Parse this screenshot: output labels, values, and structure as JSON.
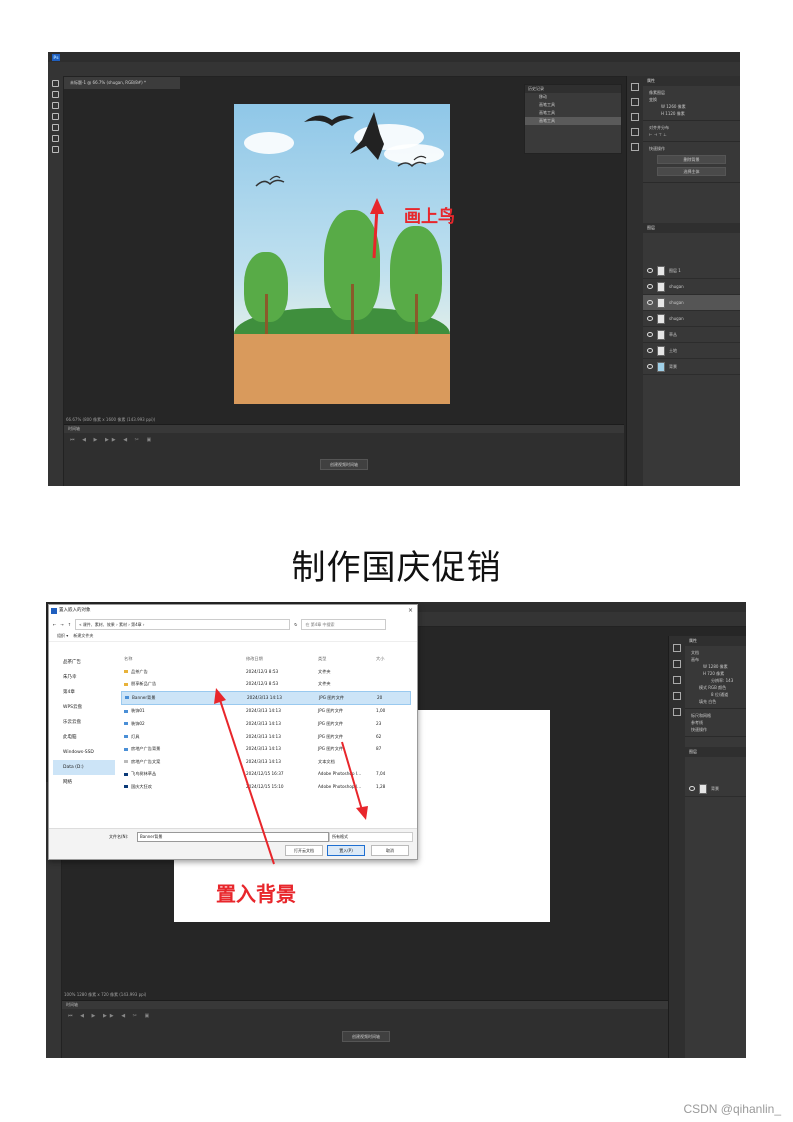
{
  "shot1": {
    "doc_tab": "未标题-1 @ 66.7% (shugan, RGB/8#) *",
    "zoom_status": "66.67%  (800 像素 x 1600 像素 (143.993 ppi))",
    "timeline_tab": "时间轴",
    "timeline_button": "创建视频时间轴",
    "history_tab": "历史记录",
    "history_items": [
      "移动",
      "画笔工具",
      "画笔工具",
      "画笔工具"
    ],
    "properties_tab": "属性",
    "properties_title": "像素图层",
    "transform_label": "变换",
    "w_value": "W  1260 像素",
    "h_value": "H  1120 像素",
    "align_label": "对齐并分布",
    "quick_actions_label": "快速操作",
    "quick_action_1": "删除背景",
    "quick_action_2": "选择主体",
    "layers_tab": "图层",
    "layers": [
      "图层 1",
      "shugan",
      "shugan",
      "shugan",
      "草丛",
      "土地",
      "背景"
    ],
    "annotation": "画上鸟"
  },
  "heading": "制作国庆促销",
  "shot2": {
    "dialog_title": "置入嵌入的对象",
    "address": "« 课件、素材、效果  ›  素材  ›  第4章  ›",
    "search_placeholder": "在 第4章 中搜索",
    "cmd_organize": "组织 ▾",
    "cmd_newfolder": "新建文件夹",
    "left_items": [
      "品茶广告",
      "朱乃幸",
      "第4章",
      "WPS云盘",
      "乐云云盘",
      "此电脑",
      "Windows-SSD",
      "Data (D:)",
      "网络"
    ],
    "columns": [
      "名称",
      "修改日期",
      "类型",
      "大小"
    ],
    "rows": [
      {
        "name": "品茶广告",
        "date": "2024/12/3 8:53",
        "type": "文件夹",
        "size": ""
      },
      {
        "name": "朋享新品广告",
        "date": "2024/12/3 8:53",
        "type": "文件夹",
        "size": ""
      },
      {
        "name": "Banner背景",
        "date": "2024/3/13 14:13",
        "type": "JPG 图片文件",
        "size": "20"
      },
      {
        "name": "装饰01",
        "date": "2024/3/13 14:13",
        "type": "JPG 图片文件",
        "size": "1,00"
      },
      {
        "name": "装饰02",
        "date": "2024/3/13 14:13",
        "type": "JPG 图片文件",
        "size": "23"
      },
      {
        "name": "灯具",
        "date": "2024/3/13 14:13",
        "type": "JPG 图片文件",
        "size": "62"
      },
      {
        "name": "房地产广告背景",
        "date": "2024/3/13 14:13",
        "type": "JPG 图片文件",
        "size": "87"
      },
      {
        "name": "房地产广告文案",
        "date": "2024/3/13 14:13",
        "type": "文本文档",
        "size": ""
      },
      {
        "name": "飞鸟树林草丛",
        "date": "2024/12/15 16:37",
        "type": "Adobe Photoshop I...",
        "size": "7,04"
      },
      {
        "name": "国庆大狂欢",
        "date": "2024/12/15 15:10",
        "type": "Adobe Photoshop I...",
        "size": "1,28"
      }
    ],
    "filename_label": "文件名(N):",
    "filename_value": "Banner背景",
    "filetype": "所有格式",
    "btn_cloud": "打开云文档",
    "btn_place": "置入(P)",
    "btn_cancel": "取消",
    "zoom_status": "100%  1280 像素 x 720 像素 (143.993 ppi)",
    "timeline_tab": "时间轴",
    "timeline_button": "创建视频时间轴",
    "properties_tab": "属性",
    "doc_label": "文档",
    "canvas_label": "画布",
    "w_value": "W  1280 像素",
    "h_value": "H  720 像素",
    "resolution": "分辨率: 143",
    "mode_value": "模式  RGB 颜色",
    "bits_value": "8 位/通道",
    "fill_value": "填充  白色",
    "rulers_label": "标尺和网格",
    "guides_label": "参考线",
    "quick_actions_label": "快速操作",
    "layers_tab": "图层",
    "layer_bg": "背景",
    "annotation": "置入背景"
  },
  "watermark": "CSDN @qihanlin_",
  "colors": {
    "annotation_red": "#e8262b",
    "ps_dark": "#262626",
    "selection_blue": "#cce4f7"
  }
}
